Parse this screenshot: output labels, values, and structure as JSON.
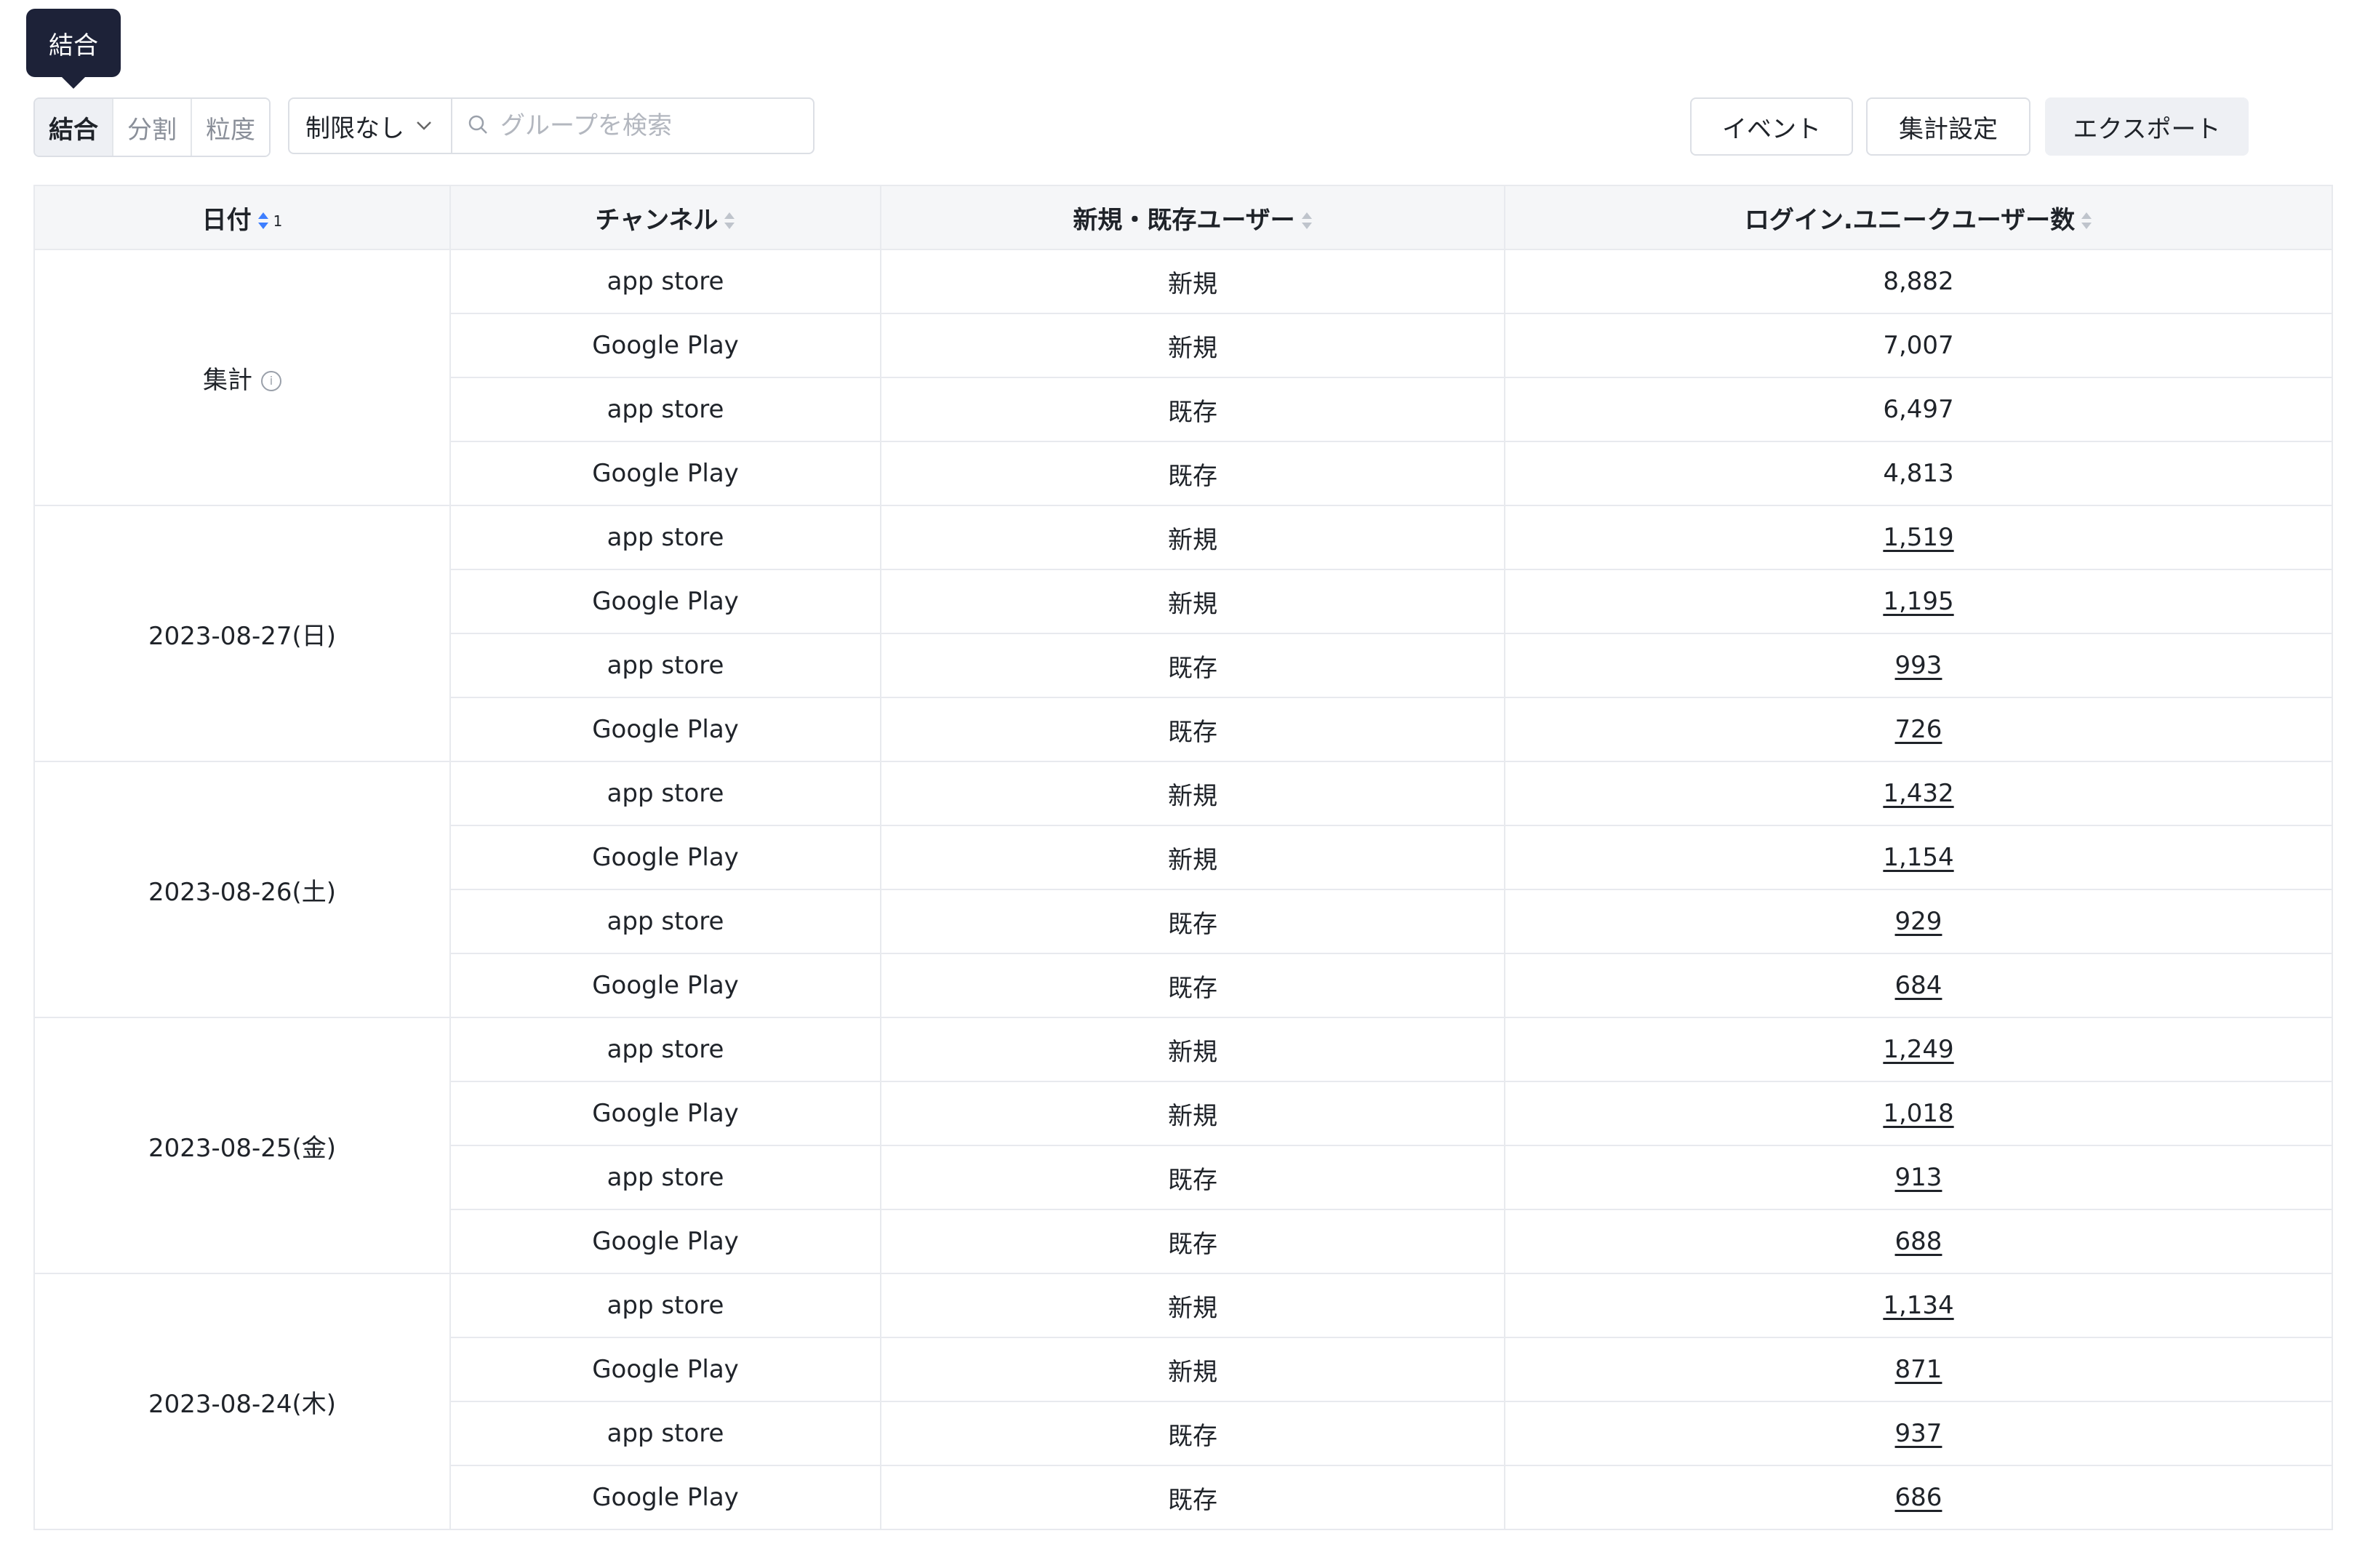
{
  "tooltip": "結合",
  "toolbar": {
    "segments": [
      "結合",
      "分割",
      "粒度"
    ],
    "limit_label": "制限なし",
    "search_placeholder": "グループを検索",
    "buttons": {
      "event": "イベント",
      "agg_settings": "集計設定",
      "export": "エクスポート"
    }
  },
  "table": {
    "headers": {
      "date": "日付",
      "date_sort_index": "1",
      "channel": "チャンネル",
      "user_type": "新規・既存ユーザー",
      "metric": "ログイン.ユニークユーザー数"
    },
    "groups": [
      {
        "date": "集計",
        "is_total": true,
        "rows": [
          {
            "channel": "app store",
            "type": "新規",
            "value": "8,882"
          },
          {
            "channel": "Google Play",
            "type": "新規",
            "value": "7,007"
          },
          {
            "channel": "app store",
            "type": "既存",
            "value": "6,497"
          },
          {
            "channel": "Google Play",
            "type": "既存",
            "value": "4,813"
          }
        ]
      },
      {
        "date": "2023-08-27(日)",
        "is_total": false,
        "rows": [
          {
            "channel": "app store",
            "type": "新規",
            "value": "1,519"
          },
          {
            "channel": "Google Play",
            "type": "新規",
            "value": "1,195"
          },
          {
            "channel": "app store",
            "type": "既存",
            "value": "993"
          },
          {
            "channel": "Google Play",
            "type": "既存",
            "value": "726"
          }
        ]
      },
      {
        "date": "2023-08-26(土)",
        "is_total": false,
        "rows": [
          {
            "channel": "app store",
            "type": "新規",
            "value": "1,432"
          },
          {
            "channel": "Google Play",
            "type": "新規",
            "value": "1,154"
          },
          {
            "channel": "app store",
            "type": "既存",
            "value": "929"
          },
          {
            "channel": "Google Play",
            "type": "既存",
            "value": "684"
          }
        ]
      },
      {
        "date": "2023-08-25(金)",
        "is_total": false,
        "rows": [
          {
            "channel": "app store",
            "type": "新規",
            "value": "1,249"
          },
          {
            "channel": "Google Play",
            "type": "新規",
            "value": "1,018"
          },
          {
            "channel": "app store",
            "type": "既存",
            "value": "913"
          },
          {
            "channel": "Google Play",
            "type": "既存",
            "value": "688"
          }
        ]
      },
      {
        "date": "2023-08-24(木)",
        "is_total": false,
        "rows": [
          {
            "channel": "app store",
            "type": "新規",
            "value": "1,134"
          },
          {
            "channel": "Google Play",
            "type": "新規",
            "value": "871"
          },
          {
            "channel": "app store",
            "type": "既存",
            "value": "937"
          },
          {
            "channel": "Google Play",
            "type": "既存",
            "value": "686"
          }
        ]
      }
    ]
  }
}
